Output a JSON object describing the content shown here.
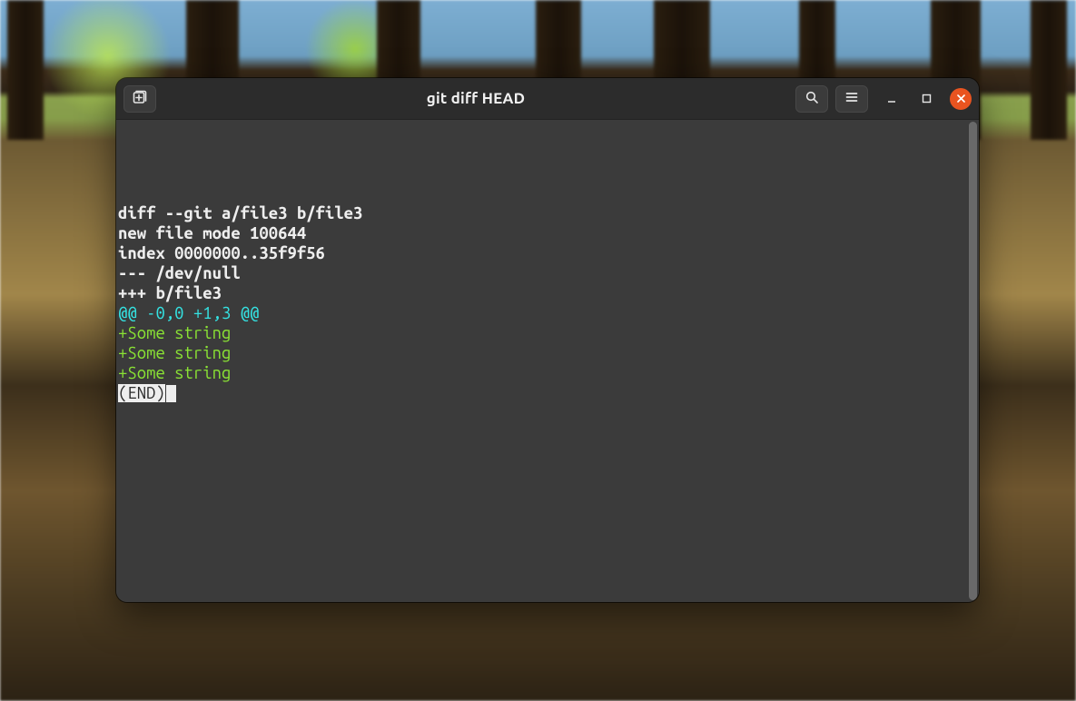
{
  "window": {
    "title": "git diff HEAD"
  },
  "icons": {
    "new_tab": "new-tab-icon",
    "search": "search-icon",
    "menu": "hamburger-icon",
    "minimize": "minimize-icon",
    "maximize": "maximize-icon",
    "close": "close-icon"
  },
  "terminal": {
    "lines": [
      {
        "type": "header",
        "text": "diff --git a/file3 b/file3"
      },
      {
        "type": "header",
        "text": "new file mode 100644"
      },
      {
        "type": "header",
        "text": "index 0000000..35f9f56"
      },
      {
        "type": "header",
        "text": "--- /dev/null"
      },
      {
        "type": "header",
        "text": "+++ b/file3"
      },
      {
        "type": "hunk",
        "text": "@@ -0,0 +1,3 @@"
      },
      {
        "type": "add",
        "text": "+Some string"
      },
      {
        "type": "add",
        "text": "+Some string"
      },
      {
        "type": "add",
        "text": "+Some string"
      }
    ],
    "pager_status": "(END)"
  },
  "colors": {
    "accent_close": "#e95420",
    "headerbar_bg": "#2c2c2c",
    "terminal_bg": "#3b3b3b",
    "diff_header": "#eeeeee",
    "diff_hunk": "#34e2e2",
    "diff_add": "#8ae234"
  }
}
